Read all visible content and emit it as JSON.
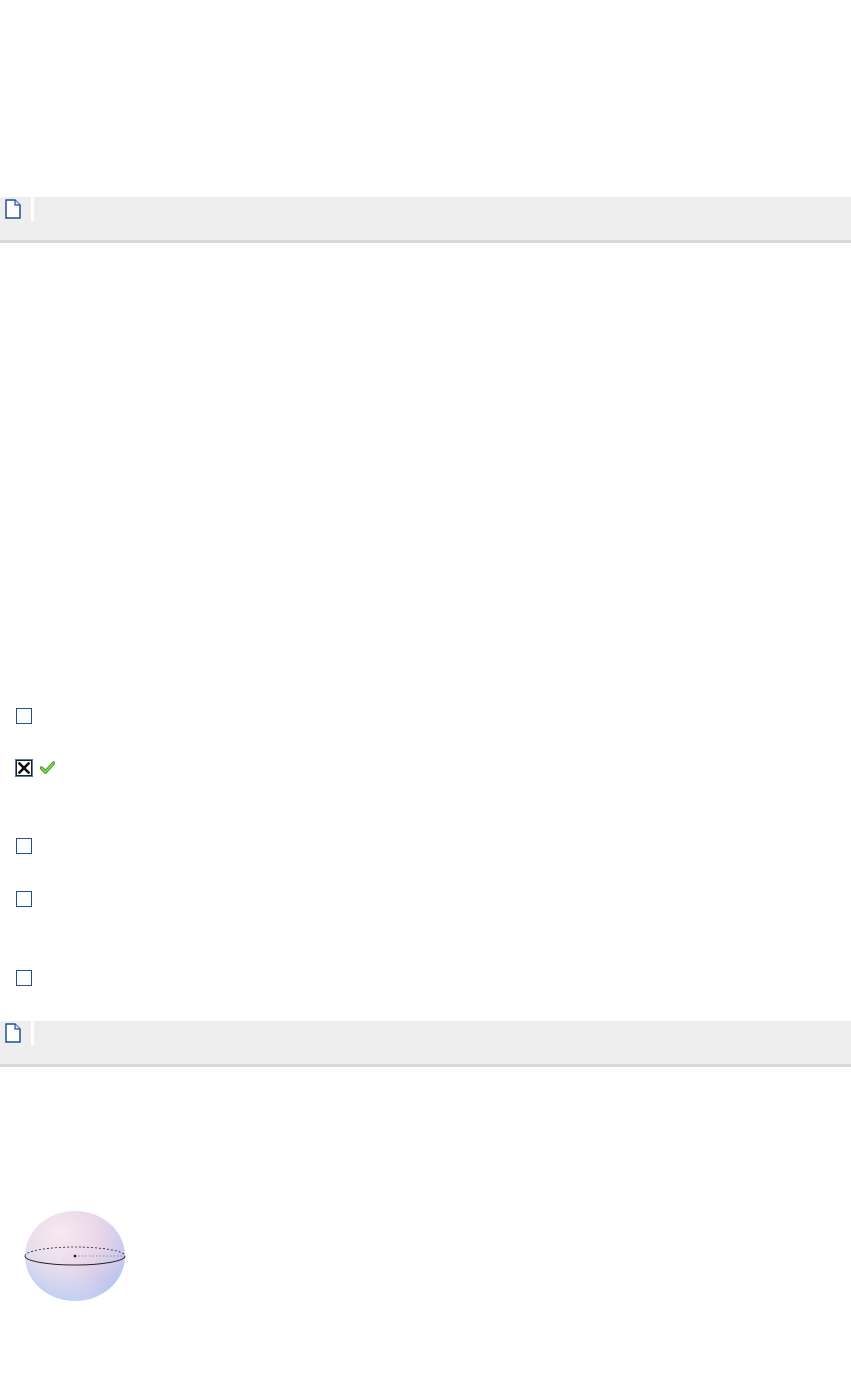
{
  "sections": [
    {
      "icon": "document-icon"
    },
    {
      "icon": "document-icon"
    }
  ],
  "question": {
    "options": [
      {
        "checked": false
      },
      {
        "checked": true,
        "feedback_icon": "green-checkmark-icon",
        "feedback_color": "#3fae2a"
      },
      {
        "checked": false
      },
      {
        "checked": false
      },
      {
        "checked": false
      }
    ]
  },
  "figure": {
    "type": "sphere-illustration",
    "colors": {
      "pink": "#f1dbe8",
      "blue": "#a9c7ef",
      "lavender": "#dcd6ee"
    }
  },
  "colors": {
    "bar_background": "#eeeeee",
    "bar_border": "#d9d9d9",
    "checkbox_border": "#1f4f9a"
  }
}
